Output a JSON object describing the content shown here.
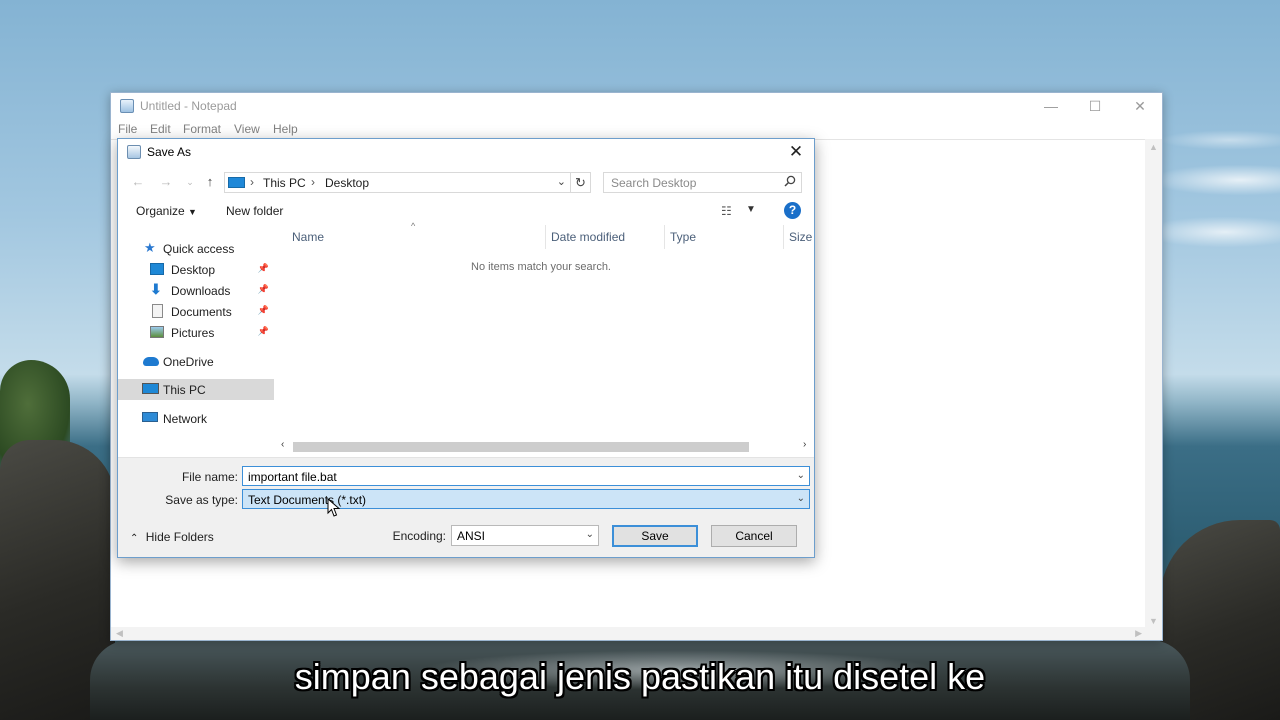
{
  "notepad": {
    "title": "Untitled - Notepad",
    "menu": [
      "File",
      "Edit",
      "Format",
      "View",
      "Help"
    ],
    "controls": {
      "minimize": "minimize-icon",
      "maximize": "maximize-icon",
      "close": "close-icon"
    }
  },
  "dialog": {
    "title": "Save As",
    "address": {
      "crumbs": [
        "This PC",
        "Desktop"
      ]
    },
    "search": {
      "placeholder": "Search Desktop"
    },
    "toolbar": {
      "organize": "Organize",
      "new_folder": "New folder"
    },
    "nav": [
      {
        "label": "Quick access",
        "icon": "star-icon"
      },
      {
        "label": "Desktop",
        "icon": "desktop-icon",
        "pinned": true
      },
      {
        "label": "Downloads",
        "icon": "download-icon",
        "pinned": true
      },
      {
        "label": "Documents",
        "icon": "documents-icon",
        "pinned": true
      },
      {
        "label": "Pictures",
        "icon": "pictures-icon",
        "pinned": true
      },
      {
        "label": "OneDrive",
        "icon": "cloud-icon"
      },
      {
        "label": "This PC",
        "icon": "computer-icon",
        "selected": true
      },
      {
        "label": "Network",
        "icon": "network-icon"
      }
    ],
    "columns": [
      "Name",
      "Date modified",
      "Type",
      "Size"
    ],
    "empty_message": "No items match your search.",
    "file_name": {
      "label": "File name:",
      "value": "important file.bat"
    },
    "save_as_type": {
      "label": "Save as type:",
      "value": "Text Documents (*.txt)"
    },
    "hide_folders": "Hide Folders",
    "encoding": {
      "label": "Encoding:",
      "value": "ANSI"
    },
    "buttons": {
      "save": "Save",
      "cancel": "Cancel"
    }
  },
  "subtitle": "simpan sebagai jenis pastikan itu disetel ke",
  "colors": {
    "accent": "#3c8fd8",
    "selection": "#cce4f7",
    "help": "#1a6fc9"
  }
}
